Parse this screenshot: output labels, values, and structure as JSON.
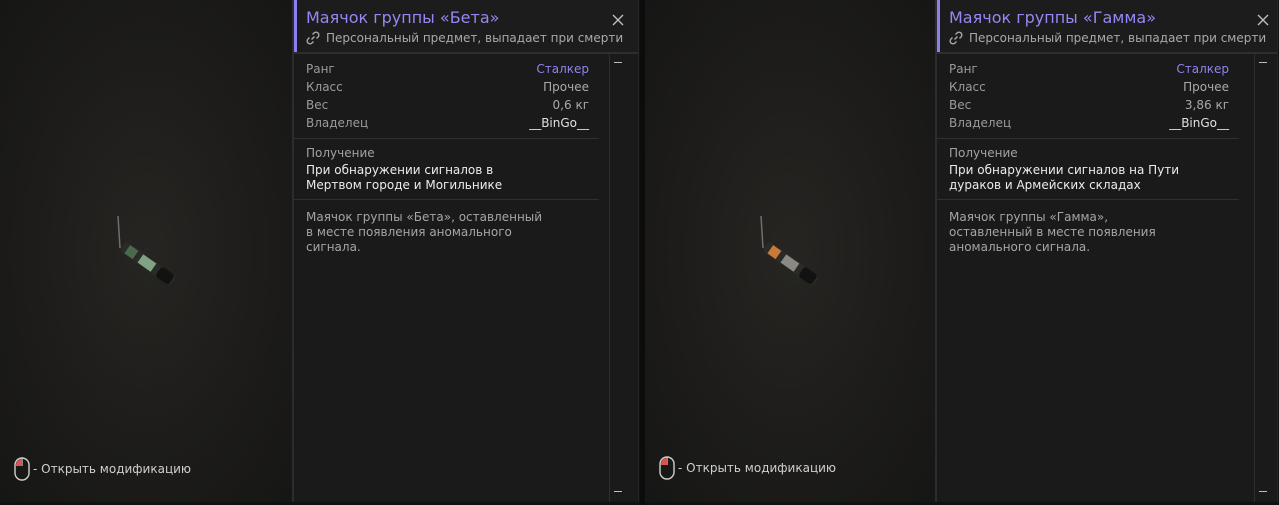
{
  "hint": {
    "open_mod": "- Открыть модификацию",
    "mouse_icon": "mouse-icon"
  },
  "labels": {
    "rank": "Ранг",
    "class": "Класс",
    "weight": "Вес",
    "owner": "Владелец",
    "obtain": "Получение"
  },
  "colors": {
    "accent": "#8a7ff0",
    "title": "#9488f4",
    "rank": "#8f84f0"
  },
  "items": [
    {
      "title": "Маячок группы «Бета»",
      "subtitle": "Персональный предмет, выпадает при смерти",
      "rank": "Сталкер",
      "class": "Прочее",
      "weight": "0,6 кг",
      "owner": "__BinGo__",
      "obtain_text": "При обнаружении сигналов в Мертвом городе и Могильнике",
      "description": "Маячок группы «Бета», оставленный в месте появления аномального сигнала.",
      "band_color": "#7fa383"
    },
    {
      "title": "Маячок группы «Гамма»",
      "subtitle": "Персональный предмет, выпадает при смерти",
      "rank": "Сталкер",
      "class": "Прочее",
      "weight": "3,86 кг",
      "owner": "__BinGo__",
      "obtain_text": "При обнаружении сигналов на Пути дураков и Армейских складах",
      "description": "Маячок группы «Гамма», оставленный в месте появления аномального сигнала.",
      "band_color": "#c77a3a"
    }
  ]
}
